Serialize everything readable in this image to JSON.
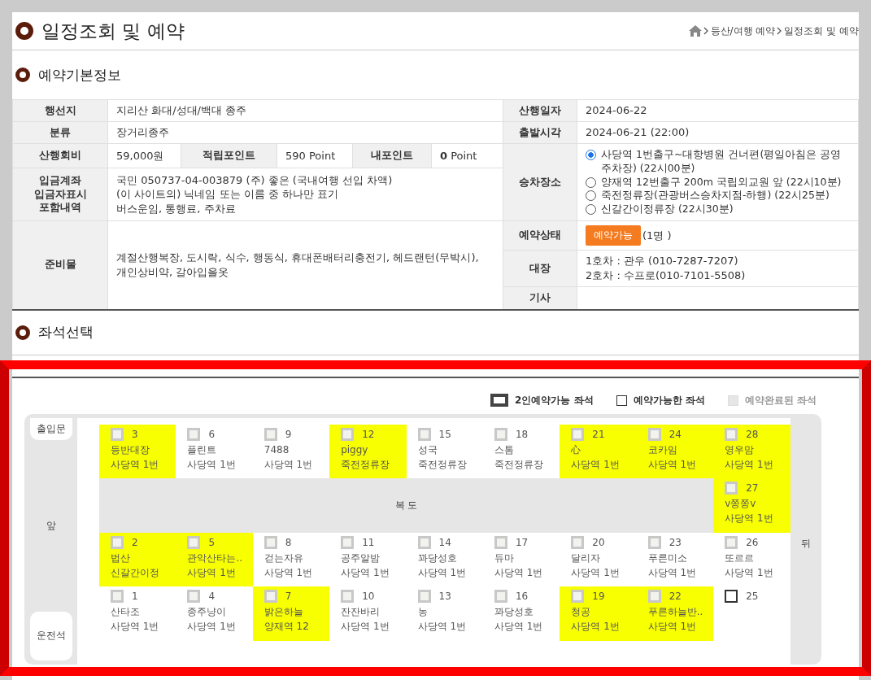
{
  "page_title": "일정조회 및 예약",
  "breadcrumb": [
    "등산/여행 예약",
    "일정조회 및 예약"
  ],
  "info_section": {
    "heading": "예약기본정보",
    "destination": {
      "label": "행선지",
      "value": "지리산 화대/성대/백대 종주"
    },
    "hike_date": {
      "label": "산행일자",
      "value": "2024-06-22"
    },
    "category": {
      "label": "분류",
      "value": "장거리종주"
    },
    "departure": {
      "label": "출발시각",
      "value": "2024-06-21 (22:00)"
    },
    "fee": {
      "label": "산행회비",
      "value": "59,000원"
    },
    "earned_points": {
      "label": "적립포인트",
      "value": "590 Point"
    },
    "my_points": {
      "label": "내포인트",
      "value": "**0** Point"
    },
    "boarding": {
      "label": "승차장소",
      "options": [
        {
          "text": "사당역 1번출구~대항병원 건너편(평일아침은 공영주차장) (22시00분)",
          "selected": true
        },
        {
          "text": "양재역 12번출구 200m 국립외교원 앞 (22시10분)",
          "selected": false
        },
        {
          "text": "죽전정류장(관광버스승차지점-하행) (22시25분)",
          "selected": false
        },
        {
          "text": "신갈간이정류장 (22시30분)",
          "selected": false
        }
      ]
    },
    "account": {
      "label_lines": [
        "입금계좌",
        "입금자표시",
        "포함내역"
      ],
      "lines": [
        "국민 050737-04-003879 (주) 좋은 (국내여행 선입 차액)",
        "(이 사이트의) 닉네임 또는 이름 중 하나만 표기",
        "버스운임, 통행료, 주차료"
      ]
    },
    "supplies": {
      "label": "준비물",
      "value": "계절산행복장, 도시락, 식수, 행동식, 휴대폰배터리충전기, 헤드랜턴(무박시), 개인상비약, 갈아입을옷"
    },
    "status": {
      "label": "예약상태",
      "button": "예약가능",
      "count": "(1명 )"
    },
    "leader": {
      "label": "대장",
      "lines": [
        "1호차 : 관우 (010-7287-7207)",
        "2호차 : 수프로(010-7101-5508)"
      ]
    },
    "driver": {
      "label": "기사"
    }
  },
  "seat_section": {
    "heading": "좌석선택",
    "legend": [
      {
        "kind": "double",
        "label": "2인예약가능 좌석"
      },
      {
        "kind": "available",
        "label": "예약가능한 좌석"
      },
      {
        "kind": "booked",
        "label": "예약완료된 좌석"
      }
    ],
    "door": "출입문",
    "front": "앞",
    "driver_seat": "운전석",
    "back": "뒤",
    "rows": [
      {
        "kind": "seats",
        "seats": [
          {
            "number": "3",
            "name": "등반대장",
            "stop": "사당역 1번",
            "booked": true,
            "highlighted": true
          },
          {
            "number": "6",
            "name": "플린트",
            "stop": "사당역 1번",
            "booked": true,
            "highlighted": false
          },
          {
            "number": "9",
            "name": "7488",
            "stop": "사당역 1번",
            "booked": true,
            "highlighted": false
          },
          {
            "number": "12",
            "name": "piggy",
            "stop": "죽전정류장",
            "booked": true,
            "highlighted": true
          },
          {
            "number": "15",
            "name": "성국",
            "stop": "죽전정류장",
            "booked": true,
            "highlighted": false
          },
          {
            "number": "18",
            "name": "스톰",
            "stop": "죽전정류장",
            "booked": true,
            "highlighted": false
          },
          {
            "number": "21",
            "name": "心",
            "stop": "사당역 1번",
            "booked": true,
            "highlighted": true
          },
          {
            "number": "24",
            "name": "코카임",
            "stop": "사당역 1번",
            "booked": true,
            "highlighted": true
          },
          {
            "number": "28",
            "name": "영우맘",
            "stop": "사당역 1번",
            "booked": true,
            "highlighted": true
          }
        ]
      },
      {
        "kind": "aisle",
        "label": "복 도",
        "seats": [
          {
            "number": "27",
            "name": "v쫑쫑v",
            "stop": "사당역 1번",
            "booked": true,
            "highlighted": true
          }
        ]
      },
      {
        "kind": "seats",
        "seats": [
          {
            "number": "2",
            "name": "법산",
            "stop": "신갈간이정",
            "booked": true,
            "highlighted": true
          },
          {
            "number": "5",
            "name": "관악산타는..",
            "stop": "사당역 1번",
            "booked": true,
            "highlighted": true
          },
          {
            "number": "8",
            "name": "걷는자유",
            "stop": "사당역 1번",
            "booked": true,
            "highlighted": false
          },
          {
            "number": "11",
            "name": "공주알밤",
            "stop": "사당역 1번",
            "booked": true,
            "highlighted": false
          },
          {
            "number": "14",
            "name": "꽈당성호",
            "stop": "사당역 1번",
            "booked": true,
            "highlighted": false
          },
          {
            "number": "17",
            "name": "듀마",
            "stop": "사당역 1번",
            "booked": true,
            "highlighted": false
          },
          {
            "number": "20",
            "name": "달리자",
            "stop": "사당역 1번",
            "booked": true,
            "highlighted": false
          },
          {
            "number": "23",
            "name": "푸른미소",
            "stop": "사당역 1번",
            "booked": true,
            "highlighted": false
          },
          {
            "number": "26",
            "name": "또르르",
            "stop": "사당역 1번",
            "booked": true,
            "highlighted": false
          }
        ]
      },
      {
        "kind": "seats",
        "seats": [
          {
            "number": "1",
            "name": "산타조",
            "stop": "사당역 1번",
            "booked": true,
            "highlighted": false
          },
          {
            "number": "4",
            "name": "종주냥이",
            "stop": "사당역 1번",
            "booked": true,
            "highlighted": false
          },
          {
            "number": "7",
            "name": "밝은하늘",
            "stop": "양재역 12",
            "booked": true,
            "highlighted": true
          },
          {
            "number": "10",
            "name": "잔잔바리",
            "stop": "사당역 1번",
            "booked": true,
            "highlighted": false
          },
          {
            "number": "13",
            "name": "농",
            "stop": "사당역 1번",
            "booked": true,
            "highlighted": false
          },
          {
            "number": "16",
            "name": "꽈당성호",
            "stop": "사당역 1번",
            "booked": true,
            "highlighted": false
          },
          {
            "number": "19",
            "name": "청공",
            "stop": "사당역 1번",
            "booked": true,
            "highlighted": true
          },
          {
            "number": "22",
            "name": "푸른하늘반..",
            "stop": "사당역 1번",
            "booked": true,
            "highlighted": true
          },
          {
            "number": "25",
            "booked": false,
            "highlighted": false
          }
        ]
      }
    ]
  }
}
